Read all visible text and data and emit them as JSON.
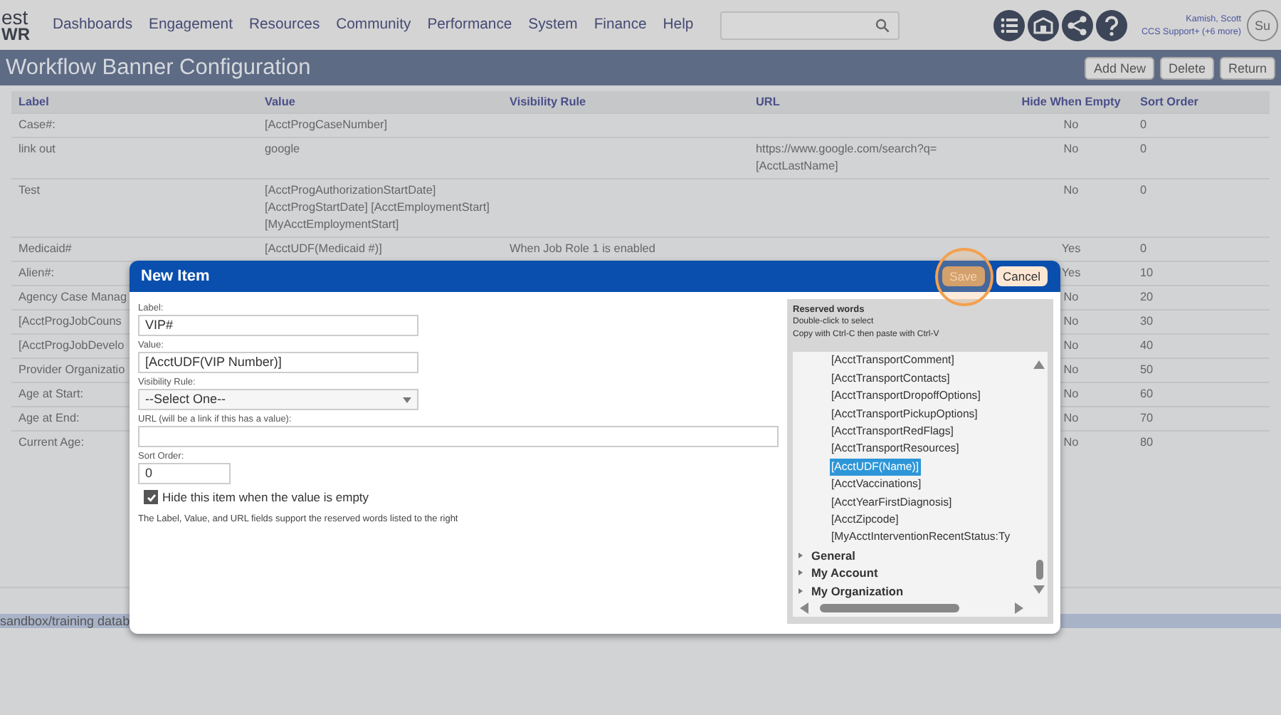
{
  "app": {
    "logo_top": "est",
    "logo_bottom": "WR"
  },
  "nav": [
    "Dashboards",
    "Engagement",
    "Resources",
    "Community",
    "Performance",
    "System",
    "Finance",
    "Help"
  ],
  "user": {
    "name": "Kamish, Scott",
    "role": "CCS Support+ (+6 more)",
    "avatar_alt": "Su"
  },
  "page": {
    "title": "Workflow Banner Configuration",
    "buttons": [
      "Add New",
      "Delete",
      "Return"
    ]
  },
  "table": {
    "columns": [
      "Label",
      "Value",
      "Visibility Rule",
      "URL",
      "Hide When Empty",
      "Sort Order"
    ],
    "rows": [
      {
        "label": "Case#:",
        "value": [
          "[AcctProgCaseNumber]"
        ],
        "hide_when_empty": "No",
        "sort_order": "0"
      },
      {
        "label": "link out",
        "value": [
          "google"
        ],
        "url": [
          "https://www.google.com/search?q=",
          "[AcctLastName]"
        ],
        "hide_when_empty": "No",
        "sort_order": "0"
      },
      {
        "label": "Test",
        "value": [
          "[AcctProgAuthorizationStartDate]",
          "[AcctProgStartDate] [AcctEmploymentStart]",
          "[MyAcctEmploymentStart]"
        ],
        "hide_when_empty": "No",
        "sort_order": "0"
      },
      {
        "label": "Medicaid#",
        "value": [
          "[AcctUDF(Medicaid #)]"
        ],
        "visibility_rule": "When Job Role 1 is enabled",
        "hide_when_empty": "Yes",
        "sort_order": "0"
      },
      {
        "label": "Alien#:",
        "hide_when_empty": "Yes",
        "sort_order": "10"
      },
      {
        "label": "Agency Case Manag",
        "hide_when_empty": "No",
        "sort_order": "20"
      },
      {
        "label": "[AcctProgJobCouns",
        "hide_when_empty": "No",
        "sort_order": "30"
      },
      {
        "label": "[AcctProgJobDevelo",
        "hide_when_empty": "No",
        "sort_order": "40"
      },
      {
        "label": "Provider Organizatio",
        "hide_when_empty": "No",
        "sort_order": "50"
      },
      {
        "label": "Age at Start:",
        "hide_when_empty": "No",
        "sort_order": "60"
      },
      {
        "label": "Age at End:",
        "hide_when_empty": "No",
        "sort_order": "70"
      },
      {
        "label": "Current Age:",
        "hide_when_empty": "No",
        "sort_order": "80"
      }
    ]
  },
  "status_bar": "sandbox/training datab",
  "dialog": {
    "title": "New Item",
    "buttons": [
      {
        "label": "Save",
        "kind": "primary",
        "highlighted": true
      },
      {
        "label": "Cancel",
        "kind": "secondary",
        "highlighted": false
      }
    ],
    "fields": [
      {
        "kind": "text",
        "label": "Label:",
        "value": "VIP#"
      },
      {
        "kind": "text",
        "label": "Value:",
        "value": "[AcctUDF(VIP Number)]"
      },
      {
        "kind": "select",
        "label": "Visibility Rule:",
        "value": "--Select One--"
      },
      {
        "kind": "wide",
        "label": "URL (will be a link if this has a value):"
      },
      {
        "kind": "short",
        "label": "Sort Order:",
        "value": "0"
      }
    ],
    "checkbox": {
      "label": "Hide this item when the value is empty",
      "checked": true
    },
    "note": "The Label, Value, and URL fields support the reserved words listed to the right",
    "reserved": {
      "title": "Reserved words",
      "hints": [
        "Double-click to select",
        "Copy with Ctrl-C then paste with Ctrl-V"
      ],
      "items": [
        {
          "label": "[AcctTransportComment]",
          "selected": false
        },
        {
          "label": "[AcctTransportContacts]",
          "selected": false
        },
        {
          "label": "[AcctTransportDropoffOptions]",
          "selected": false
        },
        {
          "label": "[AcctTransportPickupOptions]",
          "selected": false
        },
        {
          "label": "[AcctTransportRedFlags]",
          "selected": false
        },
        {
          "label": "[AcctTransportResources]",
          "selected": false
        },
        {
          "label": "[AcctUDF(Name)]",
          "selected": true
        },
        {
          "label": "[AcctVaccinations]",
          "selected": false
        },
        {
          "label": "[AcctYearFirstDiagnosis]",
          "selected": false
        },
        {
          "label": "[AcctZipcode]",
          "selected": false
        },
        {
          "label": "[MyAcctInterventionRecentStatus:Ty",
          "selected": false
        }
      ],
      "groups": [
        {
          "label": "General",
          "expanded": false
        },
        {
          "label": "My Account",
          "expanded": false
        },
        {
          "label": "My Organization",
          "expanded": false
        }
      ]
    }
  }
}
